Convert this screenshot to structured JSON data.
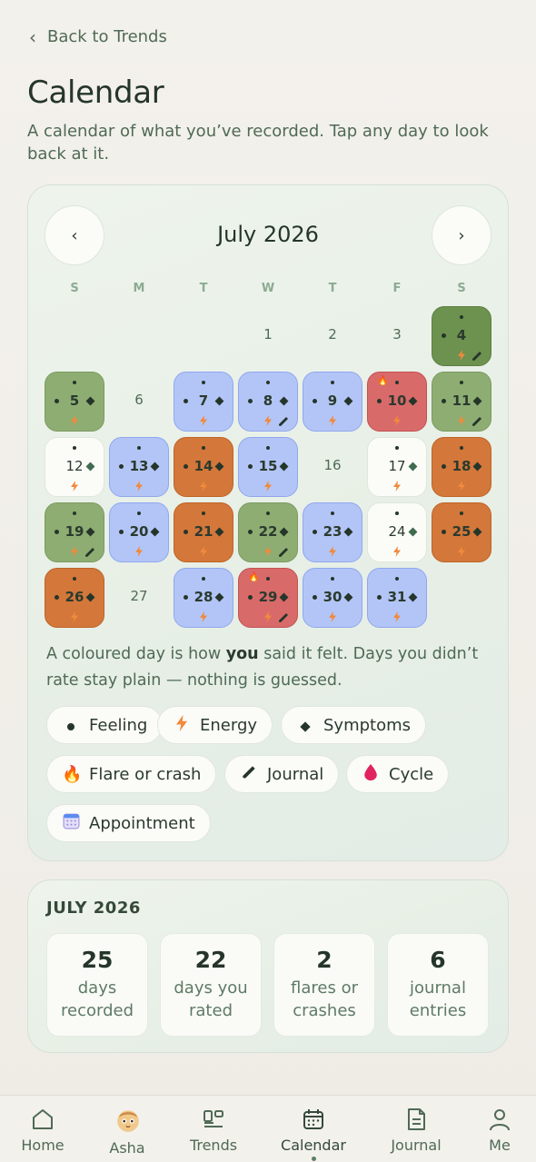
{
  "back_label": "Back to Trends",
  "title": "Calendar",
  "subtitle": "A calendar of what you’ve recorded. Tap any day to look back at it.",
  "calendar": {
    "prev_label": "‹",
    "next_label": "›",
    "month": "July 2026",
    "weekdays": [
      "S",
      "M",
      "T",
      "W",
      "T",
      "F",
      "S"
    ],
    "first_weekday": 3,
    "days": [
      {
        "d": 1,
        "mood": "plain"
      },
      {
        "d": 2,
        "mood": "plain"
      },
      {
        "d": 3,
        "mood": "plain"
      },
      {
        "d": 4,
        "mood": "dkgreen",
        "marks": [
          "feeling_top",
          "feeling",
          "energy",
          "journal"
        ]
      },
      {
        "d": 5,
        "mood": "green",
        "marks": [
          "feeling_top",
          "feeling",
          "symptoms",
          "energy"
        ]
      },
      {
        "d": 6,
        "mood": "plain"
      },
      {
        "d": 7,
        "mood": "blue",
        "marks": [
          "feeling_top",
          "feeling",
          "symptoms",
          "energy"
        ]
      },
      {
        "d": 8,
        "mood": "blue",
        "marks": [
          "feeling_top",
          "feeling",
          "symptoms",
          "energy",
          "journal"
        ]
      },
      {
        "d": 9,
        "mood": "blue",
        "marks": [
          "feeling_top",
          "feeling",
          "symptoms",
          "energy"
        ]
      },
      {
        "d": 10,
        "mood": "red",
        "marks": [
          "flare",
          "feeling_top",
          "feeling",
          "symptoms",
          "energy"
        ]
      },
      {
        "d": 11,
        "mood": "green",
        "marks": [
          "feeling_top",
          "feeling",
          "symptoms",
          "energy",
          "journal"
        ]
      },
      {
        "d": 12,
        "mood": "white",
        "marks": [
          "feeling_top",
          "symptoms",
          "energy"
        ]
      },
      {
        "d": 13,
        "mood": "blue",
        "marks": [
          "feeling_top",
          "feeling",
          "symptoms",
          "energy"
        ]
      },
      {
        "d": 14,
        "mood": "orange",
        "marks": [
          "feeling_top",
          "feeling",
          "symptoms",
          "energy"
        ]
      },
      {
        "d": 15,
        "mood": "blue",
        "marks": [
          "feeling_top",
          "feeling",
          "symptoms",
          "energy"
        ]
      },
      {
        "d": 16,
        "mood": "plain"
      },
      {
        "d": 17,
        "mood": "white",
        "marks": [
          "feeling_top",
          "symptoms",
          "energy"
        ]
      },
      {
        "d": 18,
        "mood": "orange",
        "marks": [
          "feeling_top",
          "feeling",
          "symptoms",
          "energy"
        ]
      },
      {
        "d": 19,
        "mood": "green",
        "marks": [
          "feeling_top",
          "feeling",
          "symptoms",
          "energy",
          "journal"
        ]
      },
      {
        "d": 20,
        "mood": "blue",
        "marks": [
          "feeling_top",
          "feeling",
          "symptoms",
          "energy"
        ]
      },
      {
        "d": 21,
        "mood": "orange",
        "marks": [
          "feeling_top",
          "feeling",
          "symptoms",
          "energy"
        ]
      },
      {
        "d": 22,
        "mood": "green",
        "marks": [
          "feeling_top",
          "feeling",
          "symptoms",
          "energy",
          "journal"
        ]
      },
      {
        "d": 23,
        "mood": "blue",
        "marks": [
          "feeling_top",
          "feeling",
          "symptoms",
          "energy"
        ]
      },
      {
        "d": 24,
        "mood": "white",
        "marks": [
          "feeling_top",
          "symptoms",
          "energy"
        ]
      },
      {
        "d": 25,
        "mood": "orange",
        "marks": [
          "feeling_top",
          "feeling",
          "symptoms",
          "energy"
        ]
      },
      {
        "d": 26,
        "mood": "orange",
        "marks": [
          "feeling_top",
          "feeling",
          "symptoms",
          "energy"
        ]
      },
      {
        "d": 27,
        "mood": "plain"
      },
      {
        "d": 28,
        "mood": "blue",
        "marks": [
          "feeling_top",
          "feeling",
          "symptoms",
          "energy"
        ]
      },
      {
        "d": 29,
        "mood": "red",
        "marks": [
          "flare",
          "feeling_top",
          "feeling",
          "symptoms",
          "energy",
          "journal"
        ]
      },
      {
        "d": 30,
        "mood": "blue",
        "marks": [
          "feeling_top",
          "feeling",
          "symptoms",
          "energy"
        ]
      },
      {
        "d": 31,
        "mood": "blue",
        "marks": [
          "feeling_top",
          "feeling",
          "symptoms",
          "energy"
        ]
      }
    ],
    "caption_before": "A coloured day is how ",
    "caption_bold": "you",
    "caption_after": " said it felt. Days you didn’t rate stay plain — nothing is guessed.",
    "legend": [
      {
        "key": "feeling",
        "label": "Feeling",
        "icon": "dot-icon"
      },
      {
        "key": "energy",
        "label": "Energy",
        "icon": "bolt-icon"
      },
      {
        "key": "symptoms",
        "label": "Symptoms",
        "icon": "diamond-icon"
      },
      {
        "key": "flare",
        "label": "Flare or crash",
        "icon": "fire-icon"
      },
      {
        "key": "journal",
        "label": "Journal",
        "icon": "pen-icon"
      },
      {
        "key": "cycle",
        "label": "Cycle",
        "icon": "drop-icon"
      },
      {
        "key": "appointment",
        "label": "Appointment",
        "icon": "calendar-icon"
      }
    ]
  },
  "stats": {
    "title": "JULY 2026",
    "items": [
      {
        "value": "25",
        "label": "days recorded"
      },
      {
        "value": "22",
        "label": "days you rated"
      },
      {
        "value": "2",
        "label": "flares or crashes"
      },
      {
        "value": "6",
        "label": "journal entries"
      }
    ]
  },
  "tabs": [
    {
      "label": "Home",
      "icon": "home-icon"
    },
    {
      "label": "Asha",
      "icon": "asha-avatar-icon"
    },
    {
      "label": "Trends",
      "icon": "trends-icon"
    },
    {
      "label": "Calendar",
      "icon": "calendar-icon",
      "active": true
    },
    {
      "label": "Journal",
      "icon": "journal-icon"
    },
    {
      "label": "Me",
      "icon": "person-icon"
    }
  ],
  "colors": {
    "accent": "#4f6a55",
    "green": "#8ead72",
    "dark_green": "#6d914f",
    "blue": "#b3c5f7",
    "orange": "#d3773a",
    "red": "#d96a6a"
  }
}
